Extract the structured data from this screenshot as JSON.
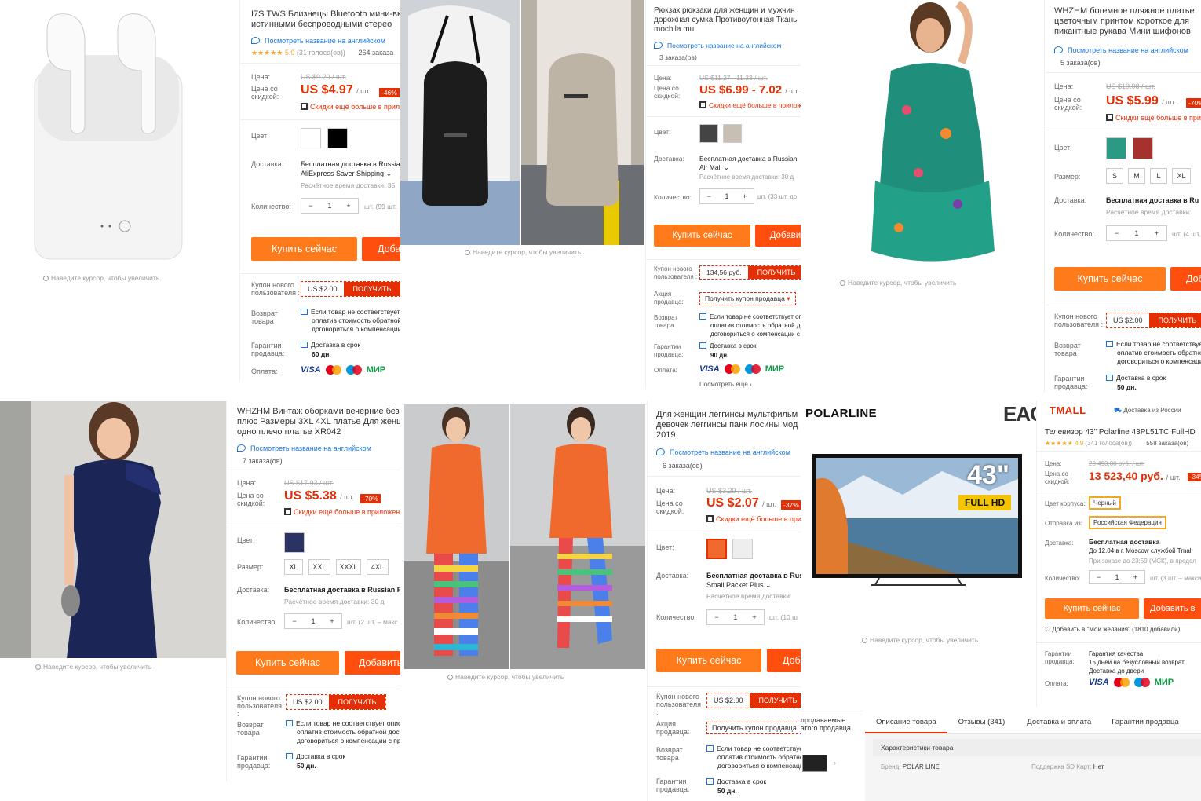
{
  "zoom_hint": "Наведите курсор, чтобы увеличить",
  "labels": {
    "price": "Цена:",
    "discount_price": "Цена со скидкой:",
    "color": "Цвет:",
    "size": "Размер:",
    "delivery": "Доставка:",
    "quantity": "Количество:",
    "coupon": "Купон нового пользователя :",
    "seller_promo": "Акция продавца:",
    "return": "Возврат товара",
    "guarantee": "Гарантии продавца:",
    "payment": "Оплата:",
    "unit": "/ шт.",
    "buy": "Купить сейчас",
    "add": "Добавить",
    "get": "ПОЛУЧИТЬ",
    "en_name": "Посмотреть название на английском",
    "more_discounts": "Скидки ещё больше в приложении",
    "free_ship_ru": "Бесплатная доставка в Russian Federation",
    "est_time": "Расчётное время доставки:",
    "return_text1": "Если товар не соответствует описанию, Вы можете вернуть его,",
    "return_text2": "оплатив стоимость обратной доставки, или",
    "return_text3": "договориться о компенсации с продавцом",
    "delivery_in": "Доставка в срок",
    "coupon_value": "US $2.00",
    "promo_seller": "Получить купон продавца",
    "payment_icons": [
      "VISA",
      "mastercard",
      "maestro",
      "МИР"
    ],
    "show_more": "Посмотреть ещё"
  },
  "p1": {
    "title1": "I7S TWS Близнецы Bluetooth мини-вкладыши",
    "title2": "истинными беспроводными стерео",
    "rating": "5.0",
    "votes": "(31 голоса(ов))",
    "orders": "264 заказа",
    "old_price": "US $9.20 / шт.",
    "price": "US $4.97",
    "discount": "-46%",
    "ship1": "Бесплатная доставка в Russian Federation",
    "ship2": "AliExpress Saver Shipping",
    "est": "Расчётное время доставки: 35",
    "qty": "1",
    "stock": "шт. (99 шт.",
    "days": "60 дн."
  },
  "p2": {
    "title1": "Рюкзак рюкзаки для женщин и мужчин",
    "title2": "дорожная сумка Противоугонная Ткань",
    "title3": "mochila mu",
    "orders": "3 заказа(ов)",
    "old_price": "US $11.27 - 11.33 / шт.",
    "price": "US $6.99 - 7.02",
    "ship1": "Бесплатная доставка в Russian",
    "ship2": "Air Mail",
    "est": "Расчётное время доставки: 30 д",
    "qty": "1",
    "stock": "шт. (33 шт. до",
    "coupon_value": "134,56 руб.",
    "days": "90 дн."
  },
  "p3": {
    "title1": "WHZHM богемное пляжное платье",
    "title2": "цветочным принтом короткое для",
    "title3": "пикантные рукава Мини шифонов",
    "orders": "5 заказа(ов)",
    "old_price": "US $19.98 / шт.",
    "price": "US $5.99",
    "discount": "-70%",
    "sizes": [
      "S",
      "M",
      "L",
      "XL"
    ],
    "ship1": "Бесплатная доставка в Ru",
    "est": "Расчётное время доставки:",
    "qty": "1",
    "stock": "шт. (4 шт.",
    "days": "50 дн."
  },
  "p4": {
    "title1": "WHZHM Винтаж оборками вечерние без",
    "title2": "плюс Размеры 3XL 4XL платье Для женщин",
    "title3": "одно плечо платье XR042",
    "orders": "7 заказа(ов)",
    "old_price": "US $17.93 / шт.",
    "price": "US $5.38",
    "discount": "-70%",
    "sizes": [
      "XL",
      "XXL",
      "XXXL",
      "4XL"
    ],
    "ship1": "Бесплатная доставка в Russian Fe",
    "est": "Расчётное время доставки: 30 д",
    "qty": "1",
    "stock": "шт. (2 шт. – макс",
    "days": "50 дн."
  },
  "p5": {
    "title1": "Для женщин леггинсы мультфильм",
    "title2": "девочек леггинсы панк лосины мод",
    "title3": "2019",
    "orders": "6 заказа(ов)",
    "old_price": "US $3.29 / шт.",
    "price": "US $2.07",
    "discount": "-37%",
    "ship1": "Бесплатная доставка в Rus",
    "ship2": "Small Packet Plus",
    "est": "Расчётное время доставки:",
    "qty": "1",
    "stock": "шт. (10 ш",
    "days": "50 дн."
  },
  "p6": {
    "brand": "POLARLINE",
    "eac": "EAC",
    "tmall": "TMALL",
    "from_ru": "Доставка из России",
    "title": "Телевизор 43\" Polarline 43PL51TC FullHD",
    "rating": "4.9",
    "votes": "(341 голоса(ов))",
    "orders": "558 заказа(ов)",
    "screen_size": "43\"",
    "full_hd": "FULL HD",
    "old_price": "20 490,00 руб. / шт.",
    "price": "13 523,40 руб.",
    "discount": "-34%",
    "body_color_label": "Цвет корпуса:",
    "body_color": "Черный",
    "ship_from_label": "Отправка из:",
    "ship_from": "Российская Федерация",
    "ship_title": "Бесплатная доставка",
    "ship_until": "До 12.04 в г. Moscow службой Tmall",
    "ship_order": "При заказе до 23:59 (МСК), в предел",
    "qty": "1",
    "stock": "шт. (3 шт. – максим",
    "add": "Добавить в",
    "wish": "Добавить в \"Мои желания\" (1810 добавили)",
    "g1": "Гарантия качества",
    "g2": "15 дней на безусловный возврат",
    "g3": "Доставка до двери",
    "tabs": [
      "Описание товара",
      "Отзывы (341)",
      "Доставка и оплата",
      "Гарантии продавца"
    ],
    "specs_title": "Характеристики товара",
    "spec_brand": "Бренд:",
    "spec_brand_val": "POLAR LINE",
    "spec_sd": "Поддержка SD Карт:",
    "spec_sd_val": "Нет",
    "seller_items1": "продаваемые",
    "seller_items2": "этого продавца"
  }
}
